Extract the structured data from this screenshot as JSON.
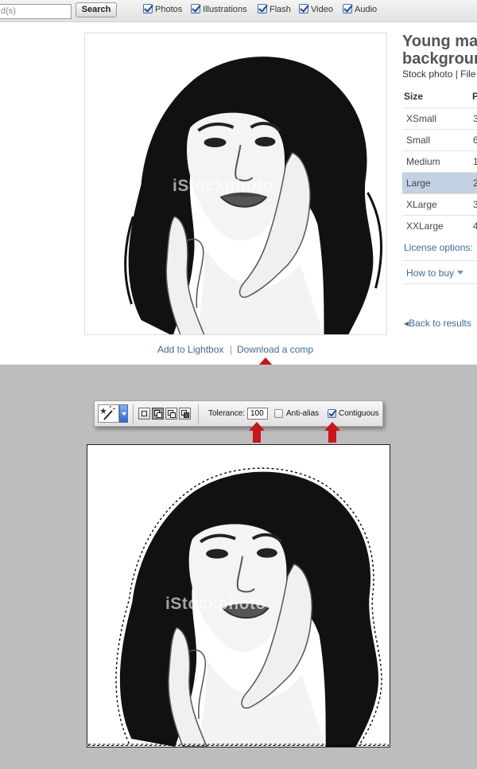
{
  "search": {
    "keyword_placeholder": "d(s)",
    "button_label": "Search",
    "filters": [
      "Photos",
      "Illustrations",
      "Flash",
      "Video",
      "Audio"
    ]
  },
  "photo": {
    "watermark": "iStockphoto"
  },
  "actions": {
    "lightbox_label": "Add to Lightbox",
    "separator": "|",
    "comp_label": "Download a comp"
  },
  "info": {
    "title_line1": "Young mag",
    "title_line2": "backgrounc",
    "subtitle": "Stock photo | File",
    "size_header": "Size",
    "pixels_header": "P",
    "sizes": [
      {
        "name": "XSmall",
        "px": "3"
      },
      {
        "name": "Small",
        "px": "6"
      },
      {
        "name": "Medium",
        "px": "1"
      },
      {
        "name": "Large",
        "px": "2"
      },
      {
        "name": "XLarge",
        "px": "3"
      },
      {
        "name": "XXLarge",
        "px": "4"
      }
    ],
    "selected_size": "Large",
    "license_label": "License options:",
    "how_to_buy_label": "How to buy",
    "back_label": "Back to results"
  },
  "toolbar": {
    "tool_icon": "magic-wand-icon",
    "tolerance_label": "Tolerance:",
    "tolerance_value": "100",
    "anti_alias_label": "Anti-alias",
    "anti_alias_checked": false,
    "contiguous_label": "Contiguous",
    "contiguous_checked": true
  },
  "colors": {
    "link": "#3d6b98",
    "arrow": "#c8161b",
    "selected_row": "#c3d2e3",
    "grey_background": "#bdbdbd"
  }
}
